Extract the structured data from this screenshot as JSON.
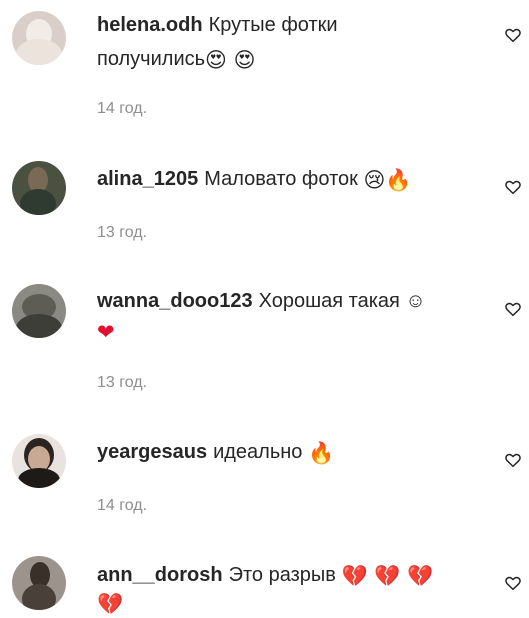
{
  "comments": [
    {
      "username": "helena.odh",
      "text_line1": "Крутые фотки",
      "text_line2": "получились",
      "emoji_line2": "😍 😍",
      "time": "14 год."
    },
    {
      "username": "alina_1205",
      "text_line1": "Маловато фоток",
      "emoji_line1": "😢🔥",
      "time": "13 год."
    },
    {
      "username": "wanna_dooo123",
      "text_line1": "Хорошая такая ☺",
      "emoji_line2": "❤",
      "time": "13 год."
    },
    {
      "username": "yeargesaus",
      "text_line1": "идеально",
      "emoji_line1": "🔥",
      "time": "14 год."
    },
    {
      "username": "ann__dorosh",
      "text_line1": "Это разрыв",
      "emoji_line1": "💔 💔 💔",
      "emoji_line2": "💔"
    }
  ],
  "icons": {
    "like": "heart-outline-icon"
  },
  "colors": {
    "text": "#262626",
    "secondary": "#8e8e8e"
  }
}
